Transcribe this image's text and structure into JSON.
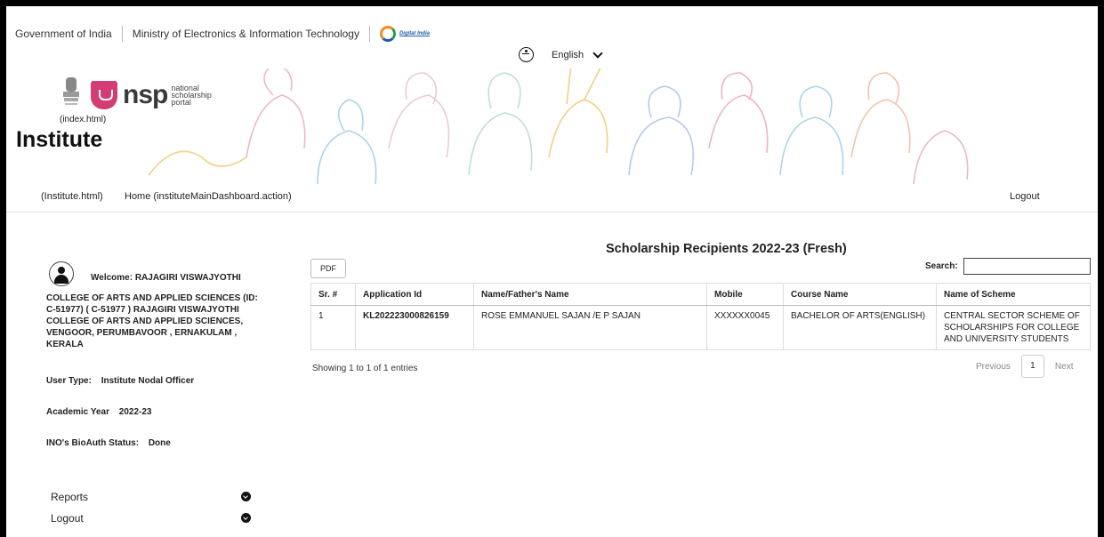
{
  "gov": {
    "goi": "Government of India",
    "meity": "Ministry of Electronics & Information Technology",
    "digital_india": "Digital India"
  },
  "accessibility": {
    "language": "English"
  },
  "brand": {
    "nsp": "nsp",
    "nsp_sub": "national scholarship portal",
    "index_link": "(index.html)",
    "title": "Institute"
  },
  "nav": {
    "institute_link": "(Institute.html)",
    "home_link": "Home (instituteMainDashboard.action)",
    "logout": "Logout"
  },
  "sidebar": {
    "welcome": "Welcome: RAJAGIRI VISWAJYOTHI",
    "college": "COLLEGE OF ARTS AND APPLIED SCIENCES (ID: C-51977) ( C-51977 ) RAJAGIRI VISWAJYOTHI COLLEGE OF ARTS AND APPLIED SCIENCES, VENGOOR, PERUMBAVOOR , ERNAKULAM , KERALA",
    "user_type_label": "User Type:",
    "user_type_value": "Institute Nodal Officer",
    "academic_year_label": "Academic Year",
    "academic_year_value": "2022-23",
    "bioauth_label": "INO's BioAuth Status:",
    "bioauth_value": "Done",
    "menu": [
      {
        "label": "Reports"
      },
      {
        "label": "Logout"
      }
    ]
  },
  "main": {
    "title": "Scholarship Recipients 2022-23 (Fresh)",
    "pdf": "PDF",
    "search_label": "Search:",
    "search_value": "",
    "columns": [
      "Sr. #",
      "Application Id",
      "Name/Father's Name",
      "Mobile",
      "Course Name",
      "Name of Scheme"
    ],
    "rows": [
      {
        "sr": "1",
        "app_id": "KL202223000826159",
        "name": "ROSE EMMANUEL SAJAN /E P SAJAN",
        "mobile": "XXXXXX0045",
        "course": "BACHELOR OF ARTS(ENGLISH)",
        "scheme": "CENTRAL SECTOR SCHEME OF SCHOLARSHIPS FOR COLLEGE AND UNIVERSITY STUDENTS"
      }
    ],
    "showing": "Showing 1 to 1 of 1 entries",
    "pager": {
      "prev": "Previous",
      "page": "1",
      "next": "Next"
    }
  }
}
